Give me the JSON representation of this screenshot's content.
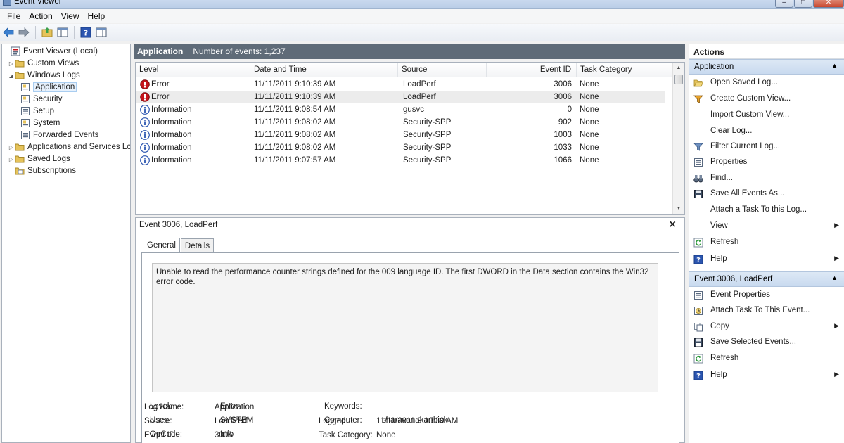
{
  "window": {
    "title": "Event Viewer",
    "buttons": [
      "–",
      "□",
      "✕"
    ]
  },
  "menu": [
    "File",
    "Action",
    "View",
    "Help"
  ],
  "tree": [
    {
      "label": "Event Viewer (Local)",
      "indent": 0,
      "expander": ""
    },
    {
      "label": "Custom Views",
      "indent": 1,
      "expander": "▷"
    },
    {
      "label": "Windows Logs",
      "indent": 1,
      "expander": "◢"
    },
    {
      "label": "Application",
      "indent": 2,
      "expander": "",
      "selected": true
    },
    {
      "label": "Security",
      "indent": 2,
      "expander": ""
    },
    {
      "label": "Setup",
      "indent": 2,
      "expander": ""
    },
    {
      "label": "System",
      "indent": 2,
      "expander": ""
    },
    {
      "label": "Forwarded Events",
      "indent": 2,
      "expander": ""
    },
    {
      "label": "Applications and Services Lo",
      "indent": 1,
      "expander": "▷"
    },
    {
      "label": "Saved Logs",
      "indent": 1,
      "expander": "▷"
    },
    {
      "label": "Subscriptions",
      "indent": 1,
      "expander": ""
    }
  ],
  "center": {
    "log_name": "Application",
    "event_count": "Number of events: 1,237",
    "columns": [
      "Level",
      "Date and Time",
      "Source",
      "Event ID",
      "Task Category"
    ],
    "rows": [
      {
        "level": "Error",
        "datetime": "11/11/2011 9:10:39 AM",
        "source": "LoadPerf",
        "event_id": "3006",
        "task": "None"
      },
      {
        "level": "Error",
        "datetime": "11/11/2011 9:10:39 AM",
        "source": "LoadPerf",
        "event_id": "3006",
        "task": "None"
      },
      {
        "level": "Information",
        "datetime": "11/11/2011 9:08:54 AM",
        "source": "gusvc",
        "event_id": "0",
        "task": "None"
      },
      {
        "level": "Information",
        "datetime": "11/11/2011 9:08:02 AM",
        "source": "Security-SPP",
        "event_id": "902",
        "task": "None"
      },
      {
        "level": "Information",
        "datetime": "11/11/2011 9:08:02 AM",
        "source": "Security-SPP",
        "event_id": "1003",
        "task": "None"
      },
      {
        "level": "Information",
        "datetime": "11/11/2011 9:08:02 AM",
        "source": "Security-SPP",
        "event_id": "1033",
        "task": "None"
      },
      {
        "level": "Information",
        "datetime": "11/11/2011 9:07:57 AM",
        "source": "Security-SPP",
        "event_id": "1066",
        "task": "None"
      }
    ]
  },
  "details": {
    "title": "Event 3006, LoadPerf",
    "close": "×",
    "tabs": [
      "General",
      "Details"
    ],
    "description": "Unable to read the performance counter strings defined for the 009 language ID. The first DWORD in the Data section contains the Win32 error code.",
    "props_left": [
      {
        "label": "Log Name:",
        "value": "Application"
      },
      {
        "label": "Source:",
        "value": "LoadPerf"
      },
      {
        "label": "Event ID:",
        "value": "3006"
      },
      {
        "label": "Level:",
        "value": "Error"
      },
      {
        "label": "User:",
        "value": "SYSTEM"
      },
      {
        "label": "OpCode:",
        "value": "Info"
      }
    ],
    "props_right": [
      {
        "label": "Logged:",
        "value": "11/11/2011 9:10:39 AM"
      },
      {
        "label": "Task Category:",
        "value": "None"
      },
      {
        "label": "Keywords:",
        "value": ""
      },
      {
        "label": "Computer:",
        "value": "sharavanakarthick"
      }
    ]
  },
  "actions": {
    "title": "Actions",
    "sections": [
      {
        "header": "Application",
        "items": [
          {
            "label": "Open Saved Log...",
            "icon": "folder-open-icon"
          },
          {
            "label": "Create Custom View...",
            "icon": "filter-icon"
          },
          {
            "label": "Import Custom View...",
            "icon": ""
          },
          {
            "label": "Clear Log...",
            "icon": ""
          },
          {
            "label": "Filter Current Log...",
            "icon": "filter-icon"
          },
          {
            "label": "Properties",
            "icon": "properties-icon"
          },
          {
            "label": "Find...",
            "icon": "binoculars-icon"
          },
          {
            "label": "Save All Events As...",
            "icon": "save-icon"
          },
          {
            "label": "Attach a Task To this Log...",
            "icon": ""
          },
          {
            "label": "View",
            "icon": "",
            "submenu": true
          },
          {
            "label": "Refresh",
            "icon": "refresh-icon"
          },
          {
            "label": "Help",
            "icon": "help-icon",
            "submenu": true
          }
        ]
      },
      {
        "header": "Event 3006, LoadPerf",
        "items": [
          {
            "label": "Event Properties",
            "icon": "properties-icon"
          },
          {
            "label": "Attach Task To This Event...",
            "icon": "task-icon"
          },
          {
            "label": "Copy",
            "icon": "copy-icon",
            "submenu": true
          },
          {
            "label": "Save Selected Events...",
            "icon": "save-icon"
          },
          {
            "label": "Refresh",
            "icon": "refresh-icon"
          },
          {
            "label": "Help",
            "icon": "help-icon",
            "submenu": true
          }
        ]
      }
    ]
  },
  "colors": {
    "header_bar": "#5f6b78",
    "section_bar": "#c9daef",
    "error": "#c6141b",
    "info": "#2b55b0"
  }
}
